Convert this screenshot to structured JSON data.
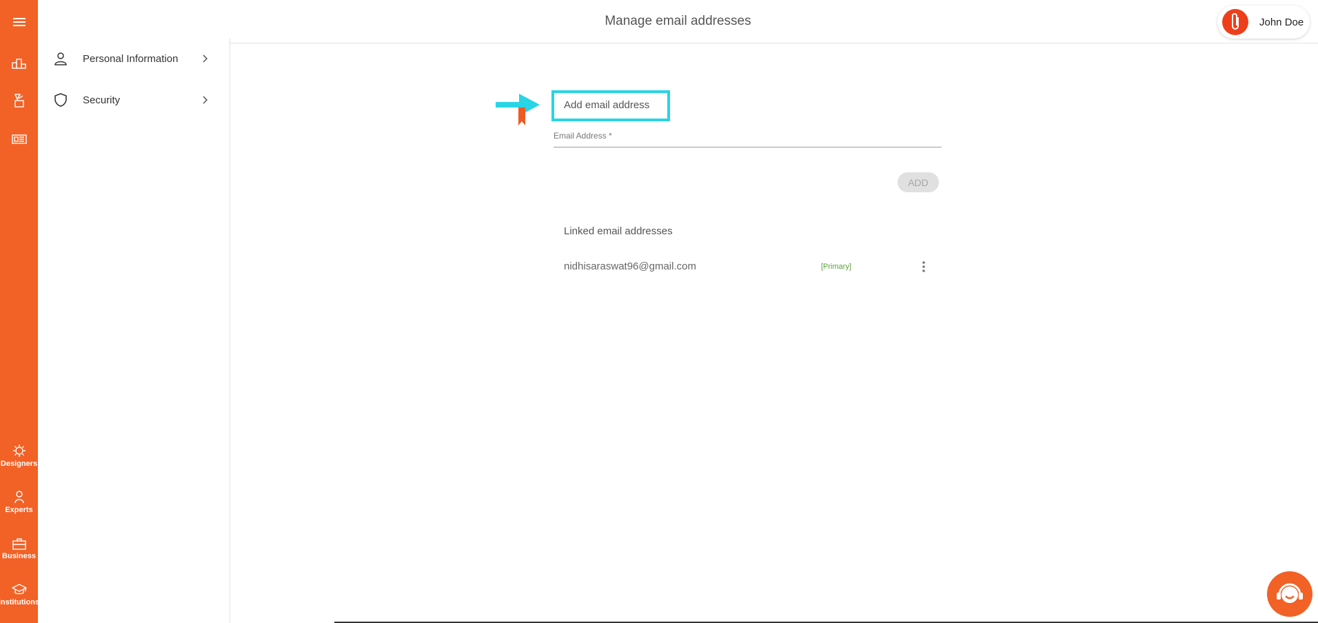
{
  "header": {
    "title": "Manage email addresses"
  },
  "user": {
    "name": "John Doe"
  },
  "rail": {
    "bottom_items": [
      {
        "label": "Designers",
        "icon": "designer-icon"
      },
      {
        "label": "Experts",
        "icon": "expert-icon"
      },
      {
        "label": "Business",
        "icon": "briefcase-icon"
      },
      {
        "label": "Institutions",
        "icon": "graduation-cap-icon"
      }
    ]
  },
  "sidebar": {
    "items": [
      {
        "label": "Personal Information",
        "icon": "person-icon"
      },
      {
        "label": "Security",
        "icon": "shield-icon"
      }
    ]
  },
  "add_email": {
    "title": "Add email address",
    "field_label": "Email Address *",
    "value": "",
    "button_label": "ADD"
  },
  "linked": {
    "title": "Linked email addresses",
    "items": [
      {
        "email": "nidhisaraswat96@gmail.com",
        "badge": "[Primary]"
      }
    ]
  },
  "colors": {
    "brand": "#f26126",
    "highlight": "#29d4e5",
    "primary_badge": "#5aa03a"
  }
}
